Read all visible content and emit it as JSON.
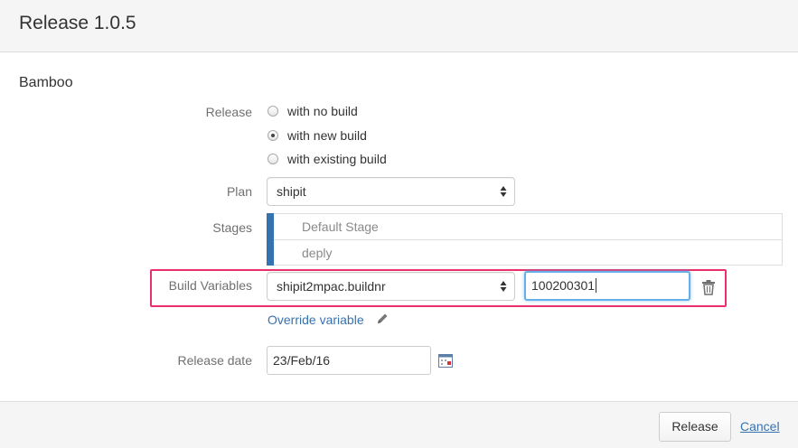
{
  "dialog": {
    "title": "Release 1.0.5"
  },
  "section": {
    "title": "Bamboo"
  },
  "release": {
    "label": "Release",
    "options": [
      {
        "label": "with no build",
        "checked": false
      },
      {
        "label": "with new build",
        "checked": true
      },
      {
        "label": "with existing build",
        "checked": false
      }
    ]
  },
  "plan": {
    "label": "Plan",
    "selected": "shipit"
  },
  "stages": {
    "label": "Stages",
    "items": [
      "Default Stage",
      "deply"
    ]
  },
  "build_variables": {
    "label": "Build Variables",
    "variable_selected": "shipit2mpac.buildnr",
    "value": "100200301",
    "override_label": "Override variable"
  },
  "release_date": {
    "label": "Release date",
    "value": "23/Feb/16"
  },
  "footer": {
    "release_button": "Release",
    "cancel_link": "Cancel"
  },
  "colors": {
    "link": "#3572b0",
    "highlight": "#e8306b",
    "stage_bar": "#3572b0",
    "focus": "#66afe9"
  },
  "icons": [
    "pencil-icon",
    "trash-icon",
    "calendar-icon",
    "select-arrows-icon"
  ]
}
